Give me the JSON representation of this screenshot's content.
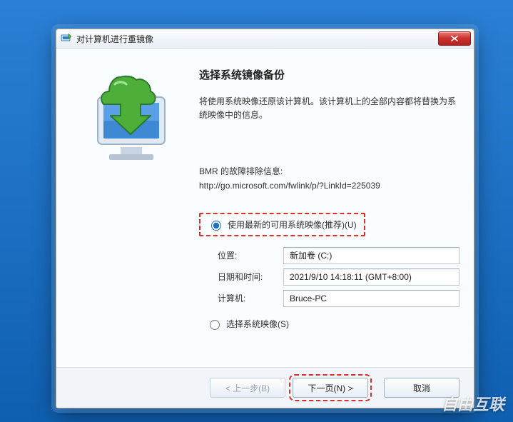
{
  "window": {
    "title": "对计算机进行重镜像"
  },
  "page": {
    "heading": "选择系统镜像备份",
    "description": "将使用系统映像还原该计算机。该计算机上的全部内容都将替换为系统映像中的信息。",
    "troubleshoot_label": "BMR 的故障排除信息:",
    "troubleshoot_url": "http://go.microsoft.com/fwlink/p/?LinkId=225039"
  },
  "options": {
    "use_latest": "使用最新的可用系统映像(推荐)(U)",
    "select_image": "选择系统映像(S)"
  },
  "fields": {
    "location_label": "位置:",
    "location_value": "新加卷 (C:)",
    "datetime_label": "日期和时间:",
    "datetime_value": "2021/9/10 14:18:11 (GMT+8:00)",
    "computer_label": "计算机:",
    "computer_value": "Bruce-PC"
  },
  "buttons": {
    "back": "< 上一步(B)",
    "next": "下一页(N) >",
    "cancel": "取消"
  },
  "watermark": "自由互联"
}
